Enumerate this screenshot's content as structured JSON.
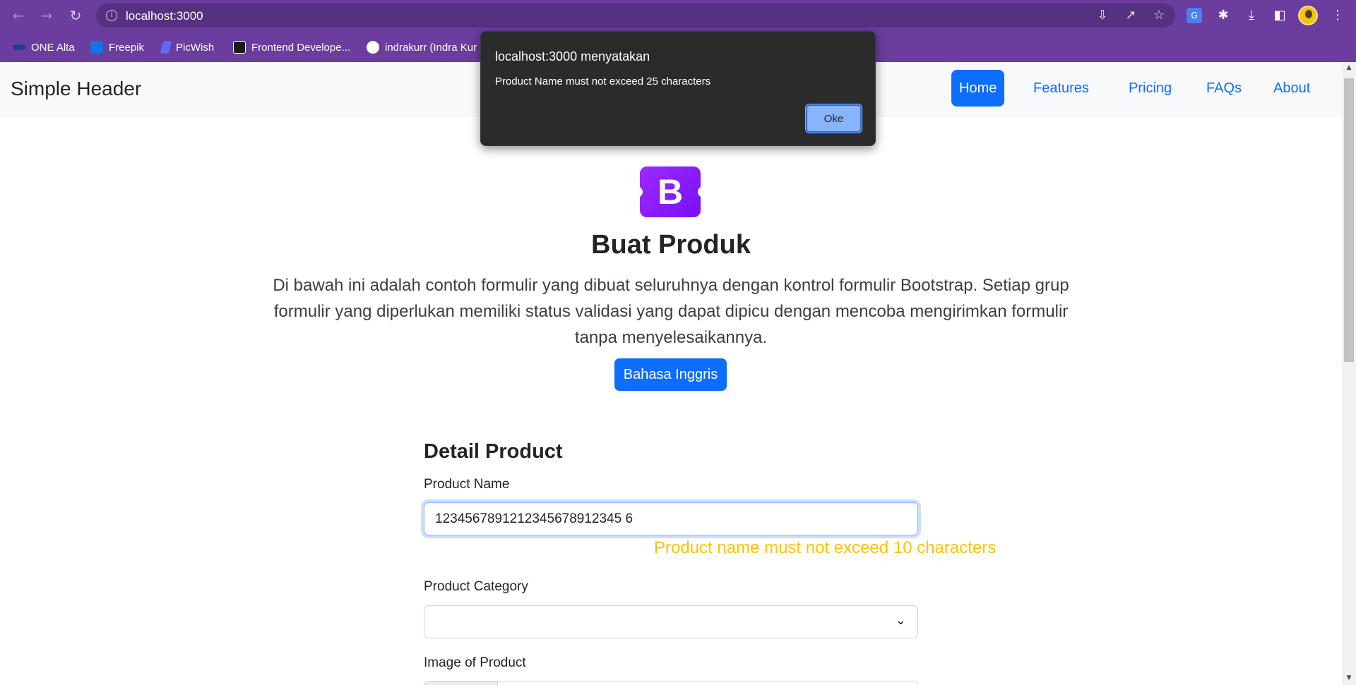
{
  "browser": {
    "url": "localhost:3000",
    "bookmarks": [
      {
        "label": "ONE Alta",
        "icon": "one-alta-icon",
        "color": "#1c3f8f"
      },
      {
        "label": "Freepik",
        "icon": "freepik-icon",
        "color": "#1273eb"
      },
      {
        "label": "PicWish",
        "icon": "picwish-icon",
        "color": "#5b6cff"
      },
      {
        "label": "Frontend Develope...",
        "icon": "frontend-mentor-icon",
        "color": "#1a1a1a"
      },
      {
        "label": "indrakurr (Indra Kur",
        "icon": "github-icon",
        "color": "#ffffff"
      }
    ]
  },
  "header": {
    "brand": "Simple Header",
    "nav": [
      "Home",
      "Features",
      "Pricing",
      "FAQs",
      "About"
    ],
    "active": "Home"
  },
  "hero": {
    "logo_letter": "B",
    "title": "Buat Produk",
    "description": "Di bawah ini adalah contoh formulir yang dibuat seluruhnya dengan kontrol formulir Bootstrap. Setiap grup formulir yang diperlukan memiliki status validasi yang dapat dipicu dengan mencoba mengirimkan formulir tanpa menyelesaikannya.",
    "button_label": "Bahasa Inggris"
  },
  "form": {
    "section_title": "Detail Product",
    "product_name_label": "Product Name",
    "product_name_value": "1234567891212345678912345 6",
    "product_name_warning": "Product name must not exceed 10 characters",
    "category_label": "Product Category",
    "category_value": "",
    "image_label": "Image of Product"
  },
  "dialog": {
    "title": "localhost:3000 menyatakan",
    "message": "Product Name must not exceed 25 characters",
    "ok_label": "Oke"
  },
  "colors": {
    "browser_chrome": "#6a3d9f",
    "primary": "#0d6efd",
    "warning": "#ffc107",
    "bootstrap_logo": "#7a0ff5"
  }
}
